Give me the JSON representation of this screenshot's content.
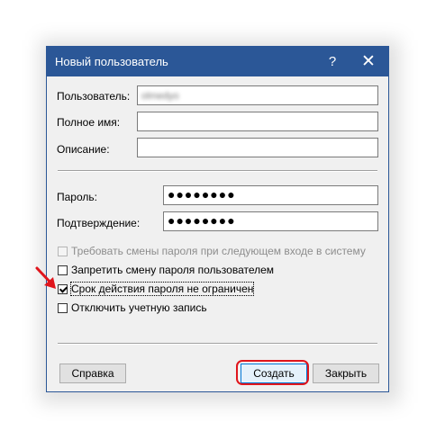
{
  "window": {
    "title": "Новый пользователь",
    "help_glyph": "?",
    "close_glyph": "✕",
    "accent_color": "#2b5797"
  },
  "fields": {
    "user_label": "Пользователь:",
    "user_value": "olmedyo",
    "fullname_label": "Полное имя:",
    "fullname_value": "",
    "description_label": "Описание:",
    "description_value": "",
    "password_label": "Пароль:",
    "password_value": "●●●●●●●●",
    "confirm_label": "Подтверждение:",
    "confirm_value": "●●●●●●●●"
  },
  "checkboxes": [
    {
      "label": "Требовать смены пароля при следующем входе в систему",
      "checked": false,
      "disabled": true
    },
    {
      "label": "Запретить смену пароля пользователем",
      "checked": false,
      "disabled": false
    },
    {
      "label": "Срок действия пароля не ограничен",
      "checked": true,
      "disabled": false
    },
    {
      "label": "Отключить учетную запись",
      "checked": false,
      "disabled": false
    }
  ],
  "buttons": {
    "help": "Справка",
    "create": "Создать",
    "close": "Закрыть"
  },
  "annotation_color": "#e0151c"
}
